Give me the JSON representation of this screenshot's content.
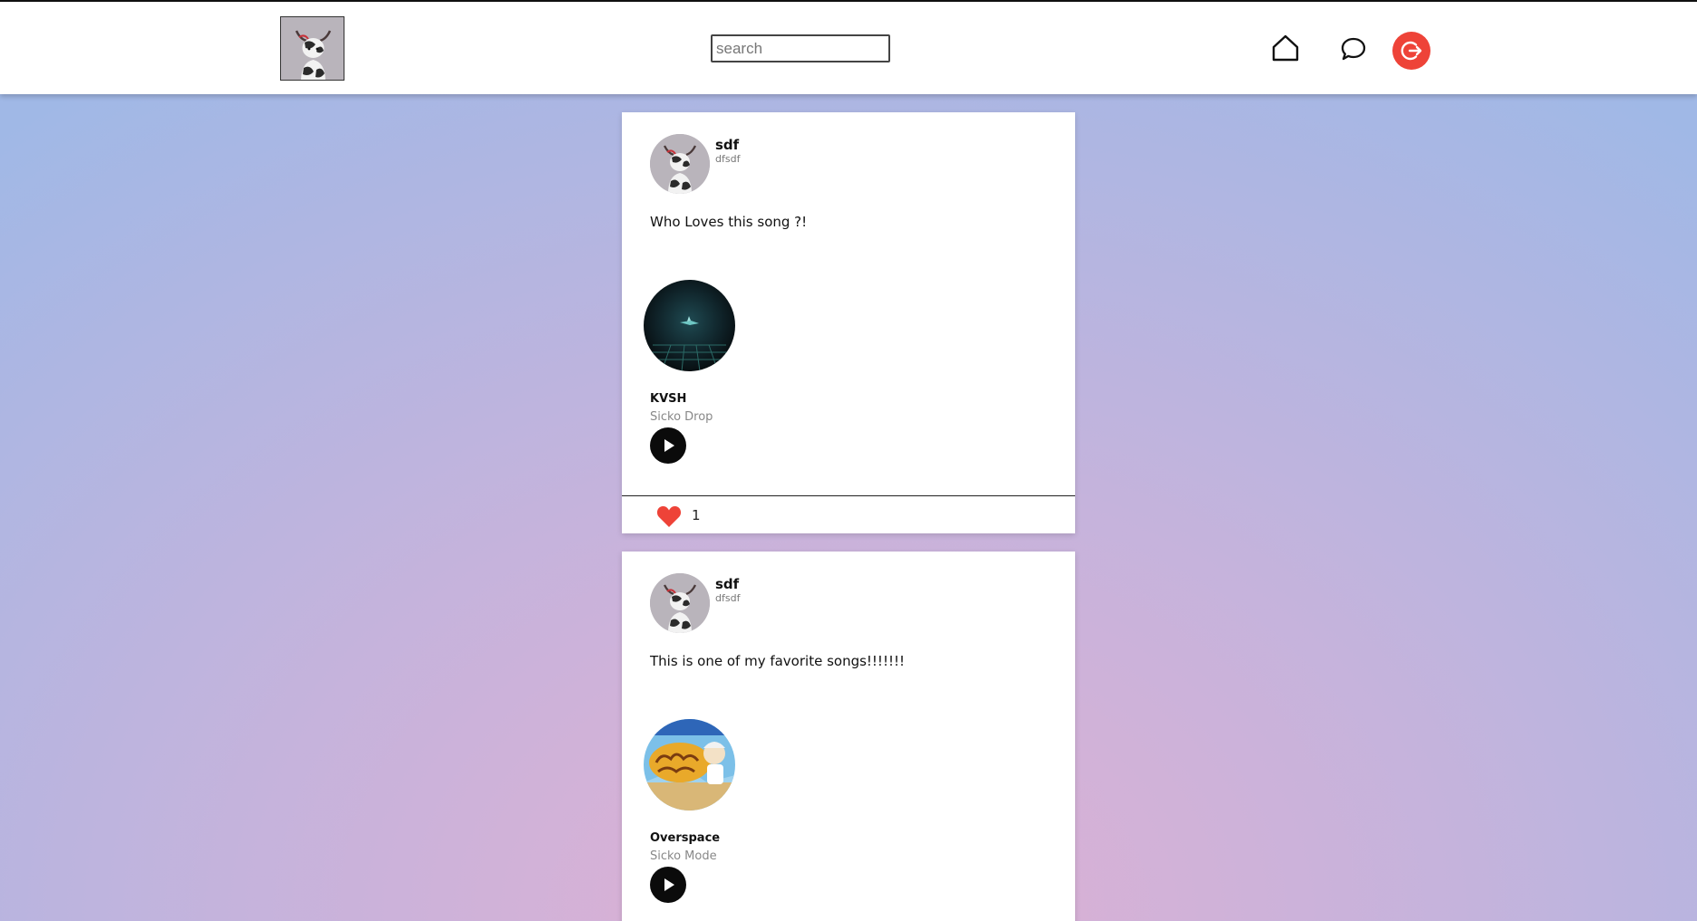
{
  "header": {
    "search_placeholder": "search"
  },
  "colors": {
    "accent_logout": "#ee4338",
    "like_heart": "#ee4338",
    "play_button": "#0b0b0b"
  },
  "icons": {
    "logo": "goat-mascot-icon",
    "home": "home-icon",
    "messages": "chat-bubble-icon",
    "logout": "logout-icon",
    "play": "play-icon",
    "like": "heart-icon"
  },
  "posts": [
    {
      "author_name": "sdf",
      "author_handle": "dfsdf",
      "text": "Who Loves this song ?!",
      "song": {
        "artist": "KVSH",
        "title": "Sicko Drop"
      },
      "likes": "1"
    },
    {
      "author_name": "sdf",
      "author_handle": "dfsdf",
      "text": "This is one of my favorite songs!!!!!!!",
      "song": {
        "artist": "Overspace",
        "title": "Sicko Mode"
      }
    }
  ]
}
